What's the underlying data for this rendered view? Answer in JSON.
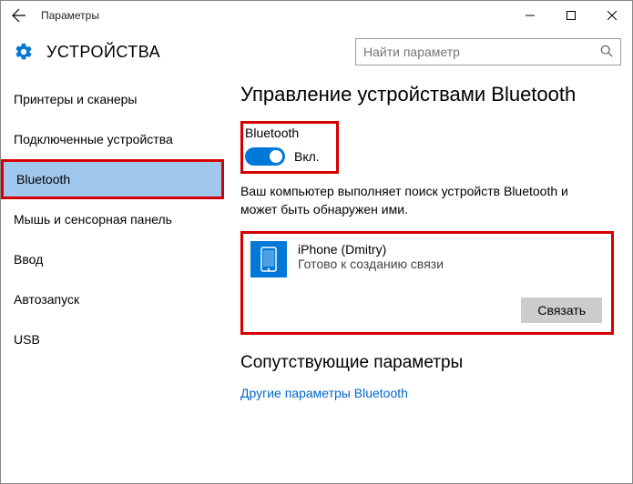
{
  "window": {
    "title": "Параметры"
  },
  "header": {
    "title": "УСТРОЙСТВА",
    "search_placeholder": "Найти параметр"
  },
  "sidebar": {
    "items": [
      {
        "label": "Принтеры и сканеры"
      },
      {
        "label": "Подключенные устройства"
      },
      {
        "label": "Bluetooth"
      },
      {
        "label": "Мышь и сенсорная панель"
      },
      {
        "label": "Ввод"
      },
      {
        "label": "Автозапуск"
      },
      {
        "label": "USB"
      }
    ],
    "selected_index": 2
  },
  "main": {
    "heading": "Управление устройствами Bluetooth",
    "toggle": {
      "label": "Bluetooth",
      "state": "Вкл.",
      "on": true
    },
    "status": "Ваш компьютер выполняет поиск устройств Bluetooth и может быть обнаружен ими.",
    "device": {
      "name": "iPhone (Dmitry)",
      "status": "Готово к созданию связи",
      "pair_label": "Связать"
    },
    "related": {
      "heading": "Сопутствующие параметры",
      "link": "Другие параметры Bluetooth"
    }
  }
}
